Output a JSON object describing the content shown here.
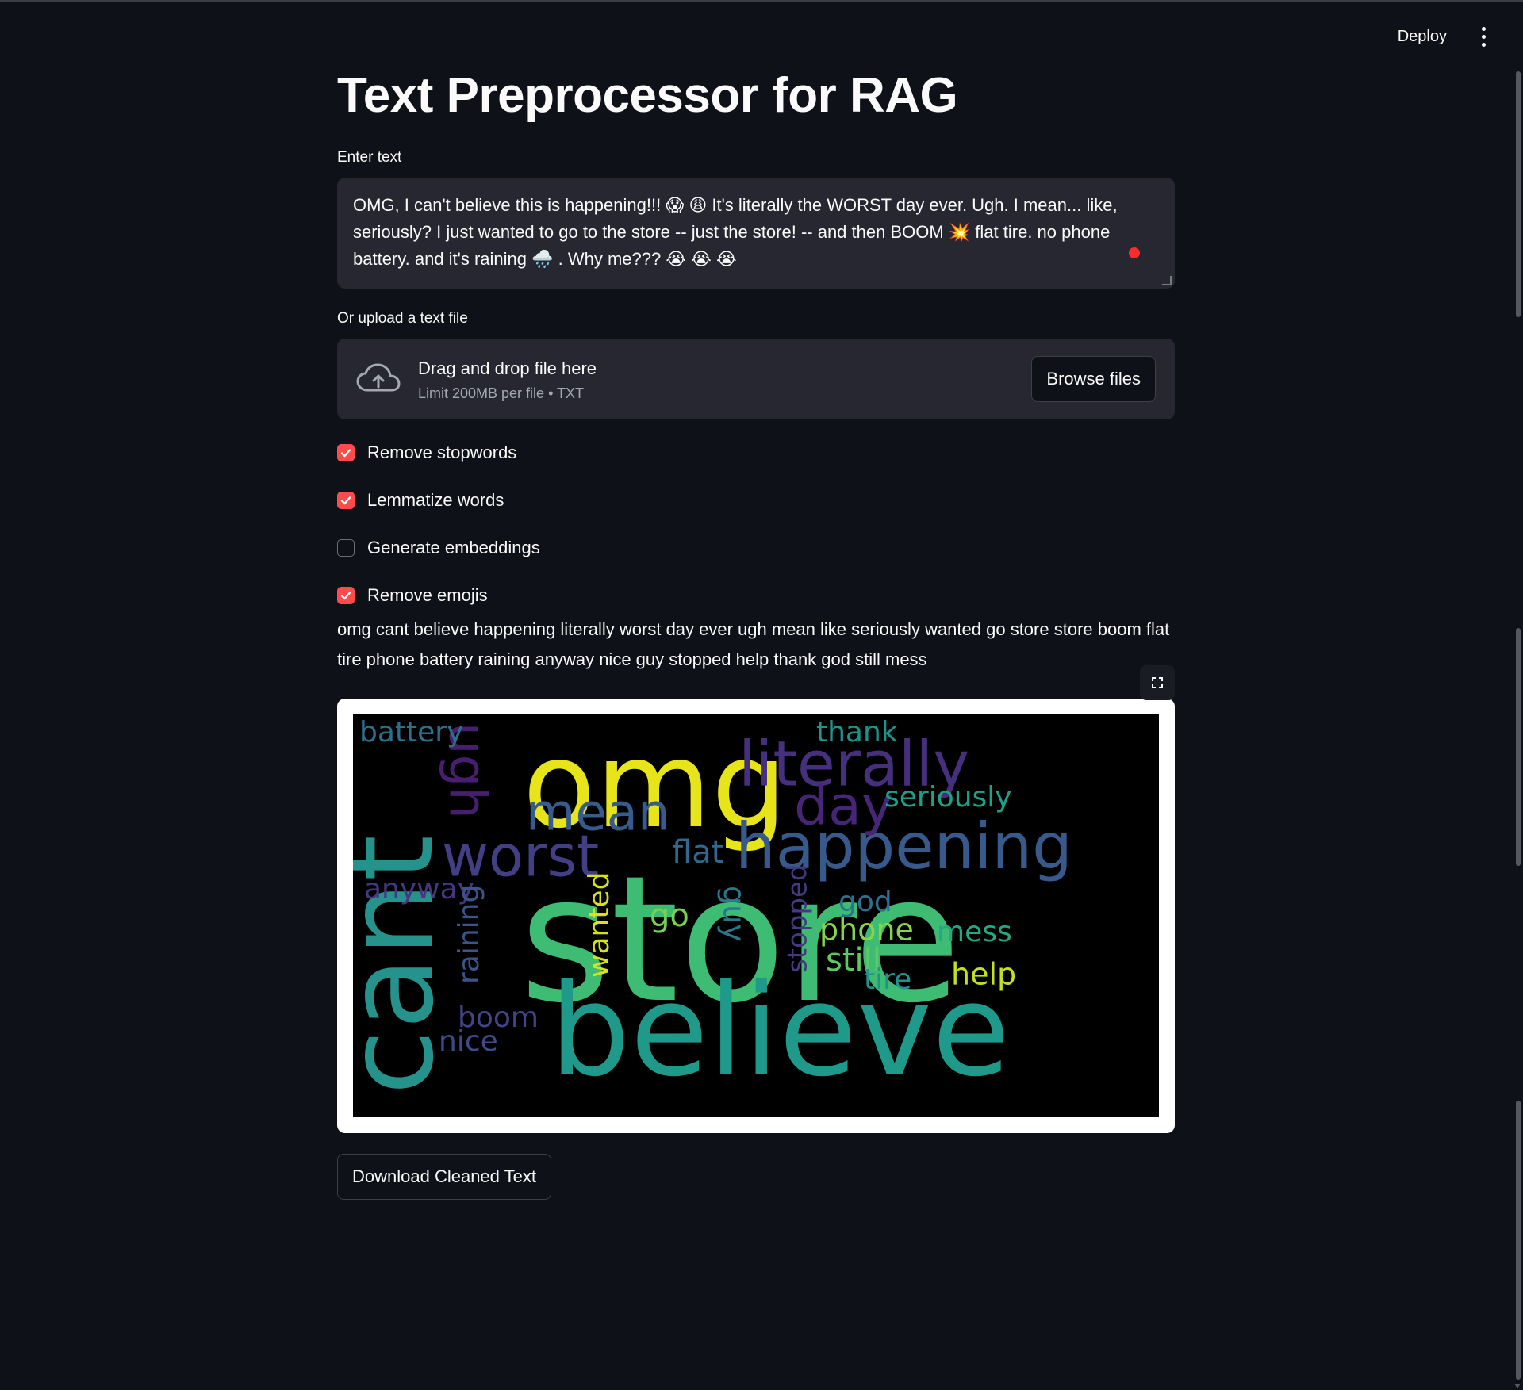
{
  "header": {
    "deploy_label": "Deploy",
    "menu_icon": "vertical-dots-icon"
  },
  "page": {
    "title": "Text Preprocessor for RAG"
  },
  "text_input": {
    "label": "Enter text",
    "value": "OMG, I can't believe this is happening!!! 😱 😩 It's literally the WORST day ever. Ugh. I mean... like, seriously? I just wanted to go to the store -- just the store! -- and then BOOM 💥 flat tire. no phone battery. and it's raining 🌧️ . Why me??? 😭 😭 😭"
  },
  "uploader": {
    "label": "Or upload a text file",
    "icon": "cloud-upload-icon",
    "title": "Drag and drop file here",
    "limit": "Limit 200MB per file • TXT",
    "browse_label": "Browse files"
  },
  "options": [
    {
      "label": "Remove stopwords",
      "checked": true
    },
    {
      "label": "Lemmatize words",
      "checked": true
    },
    {
      "label": "Generate embeddings",
      "checked": false
    },
    {
      "label": "Remove emojis",
      "checked": true
    }
  ],
  "output": {
    "cleaned_text": "omg cant believe happening literally worst day ever ugh mean like seriously wanted go store store boom flat tire phone battery raining anyway nice guy stopped help thank god still mess",
    "fullscreen_icon": "expand-icon"
  },
  "wordcloud": {
    "words": [
      {
        "text": "store",
        "color": "#3fbc73"
      },
      {
        "text": "believe",
        "color": "#1f9a8a"
      },
      {
        "text": "cant",
        "color": "#26928c"
      },
      {
        "text": "omg",
        "color": "#e7e419"
      },
      {
        "text": "literally",
        "color": "#46307e"
      },
      {
        "text": "happening",
        "color": "#38598c"
      },
      {
        "text": "worst",
        "color": "#423f85"
      },
      {
        "text": "mean",
        "color": "#365c8d"
      },
      {
        "text": "day",
        "color": "#482677"
      },
      {
        "text": "ugh",
        "color": "#481f70"
      },
      {
        "text": "seriously",
        "color": "#1fa088"
      },
      {
        "text": "battery",
        "color": "#2d708e"
      },
      {
        "text": "thank",
        "color": "#1f948c"
      },
      {
        "text": "flat",
        "color": "#31688e"
      },
      {
        "text": "anyway",
        "color": "#453781"
      },
      {
        "text": "raining",
        "color": "#39558c"
      },
      {
        "text": "wanted",
        "color": "#d8e219"
      },
      {
        "text": "go",
        "color": "#7ad151"
      },
      {
        "text": "guy",
        "color": "#2a788e"
      },
      {
        "text": "stopped",
        "color": "#443a83"
      },
      {
        "text": "god",
        "color": "#2c728e"
      },
      {
        "text": "phone",
        "color": "#86d549"
      },
      {
        "text": "mess",
        "color": "#22a884"
      },
      {
        "text": "still",
        "color": "#5ec962"
      },
      {
        "text": "tire",
        "color": "#21918c"
      },
      {
        "text": "help",
        "color": "#c2df23"
      },
      {
        "text": "boom",
        "color": "#414487"
      },
      {
        "text": "nice",
        "color": "#3e4a89"
      }
    ]
  },
  "download": {
    "label": "Download Cleaned Text"
  },
  "colors": {
    "background": "#0e1117",
    "surface": "#262730",
    "accent": "#ff4b4b",
    "text": "#fafafa"
  }
}
